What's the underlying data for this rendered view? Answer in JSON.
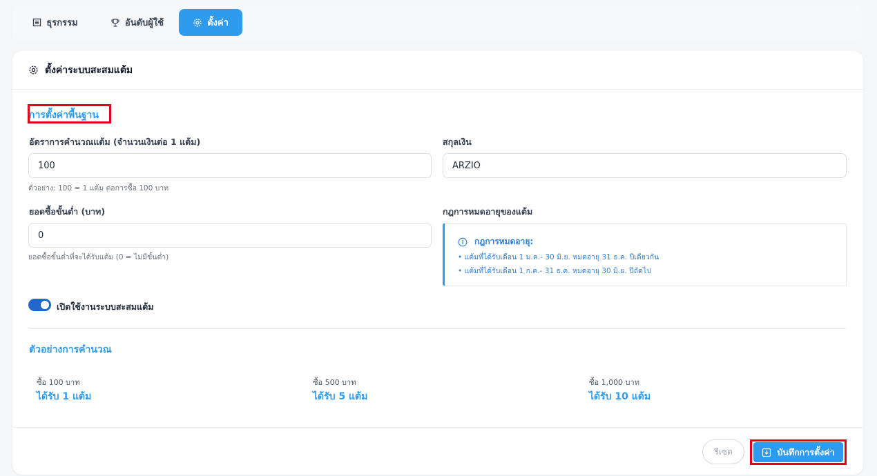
{
  "tabs": [
    {
      "label": "ธุรกรรม",
      "icon": "list-icon"
    },
    {
      "label": "อันดับผู้ใช้",
      "icon": "trophy-icon"
    },
    {
      "label": "ตั้งค่า",
      "icon": "gear-icon",
      "active": true
    }
  ],
  "card": {
    "title": "ตั้งค่าระบบสะสมแต้ม"
  },
  "basic": {
    "section_title": "การตั้งค่าพื้นฐาน",
    "rate_label": "อัตราการคำนวณแต้ม (จำนวนเงินต่อ 1 แต้ม)",
    "rate_value": "100",
    "rate_hint": "ตัวอย่าง: 100 = 1 แต้ม ต่อการซื้อ 100 บาท",
    "currency_label": "สกุลเงิน",
    "currency_value": "ARZIO",
    "min_label": "ยอดซื้อขั้นต่ำ (บาท)",
    "min_value": "0",
    "min_hint": "ยอดซื้อขั้นต่ำที่จะได้รับแต้ม (0 = ไม่มีขั้นต่ำ)",
    "expiry_label": "กฎการหมดอายุของแต้ม",
    "expiry_title": "กฎการหมดอายุ:",
    "expiry_rules": [
      "• แต้มที่ได้รับเดือน 1 ม.ค.- 30 มิ.ย. หมดอายุ 31 ธ.ค. ปีเดียวกัน",
      "• แต้มที่ได้รับเดือน 1 ก.ค.- 31 ธ.ค. หมดอายุ 30 มิ.ย. ปีถัดไป"
    ],
    "toggle_label": "เปิดใช้งานระบบสะสมแต้ม",
    "toggle_on": true
  },
  "example": {
    "section_title": "ตัวอย่างการคำนวณ",
    "items": [
      {
        "caption": "ซื้อ 100 บาท",
        "value": "ได้รับ 1 แต้ม"
      },
      {
        "caption": "ซื้อ 500 บาท",
        "value": "ได้รับ 5 แต้ม"
      },
      {
        "caption": "ซื้อ 1,000 บาท",
        "value": "ได้รับ 10 แต้ม"
      }
    ]
  },
  "actions": {
    "reset_label": "รีเซต",
    "save_label": "บันทึกการตั้งค่า"
  },
  "colors": {
    "accent": "#2f9bef",
    "toggle": "#2168c8",
    "highlight": "#e3001b"
  }
}
